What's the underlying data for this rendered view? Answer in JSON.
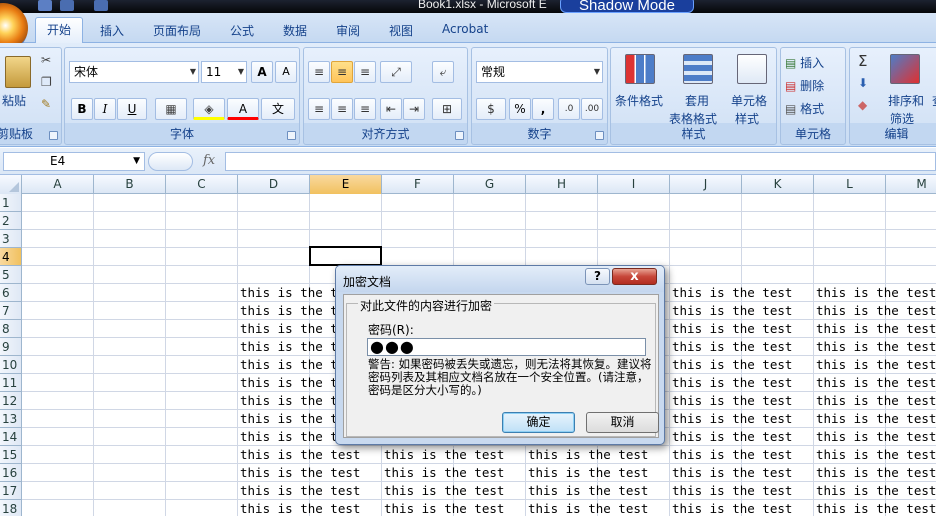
{
  "titlebar": {
    "title": "Book1.xlsx - Microsoft E",
    "overlay": "Shadow Mode"
  },
  "tabs": {
    "home": "开始",
    "items": [
      "插入",
      "页面布局",
      "公式",
      "数据",
      "审阅",
      "视图",
      "Acrobat"
    ]
  },
  "clipboard": {
    "paste": "粘贴",
    "label": "剪贴板"
  },
  "font": {
    "name": "宋体",
    "size": "11",
    "bold": "B",
    "italic": "I",
    "underline": "U",
    "grow": "A",
    "shrink": "A",
    "color_glyph": "A",
    "phonetic": "文",
    "label": "字体"
  },
  "alignment": {
    "label": "对齐方式"
  },
  "number": {
    "format": "常规",
    "percent": "%",
    "comma": ",",
    "label": "数字"
  },
  "styles": {
    "conditional": "条件格式",
    "table1": "套用",
    "table2": "表格格式",
    "cell1": "单元格",
    "cell2": "样式",
    "label": "样式"
  },
  "cells": {
    "insert": "插入",
    "delete": "删除",
    "format": "格式",
    "label": "单元格"
  },
  "editing": {
    "sort1": "排序和",
    "sort2": "筛选",
    "find": "查",
    "label": "编辑"
  },
  "formula": {
    "name": "E4",
    "fx": "fx"
  },
  "columns": [
    "A",
    "B",
    "C",
    "D",
    "E",
    "F",
    "G",
    "H",
    "I",
    "J",
    "K",
    "L",
    "M"
  ],
  "rows": [
    "1",
    "2",
    "3",
    "4",
    "5",
    "6",
    "7",
    "8",
    "9",
    "10",
    "11",
    "12",
    "13",
    "14",
    "15",
    "16",
    "17",
    "18"
  ],
  "cell_text": "this is the test",
  "dialog": {
    "title": "加密文档",
    "help": "?",
    "close": "x",
    "group_label": "对此文件的内容进行加密",
    "password_label": "密码(R):",
    "password_value": "●●●",
    "warning": "警告: 如果密码被丢失或遗忘，则无法将其恢复。建议将密码列表及其相应文档名放在一个安全位置。(请注意，密码是区分大小写的。)",
    "ok": "确定",
    "cancel": "取消"
  }
}
